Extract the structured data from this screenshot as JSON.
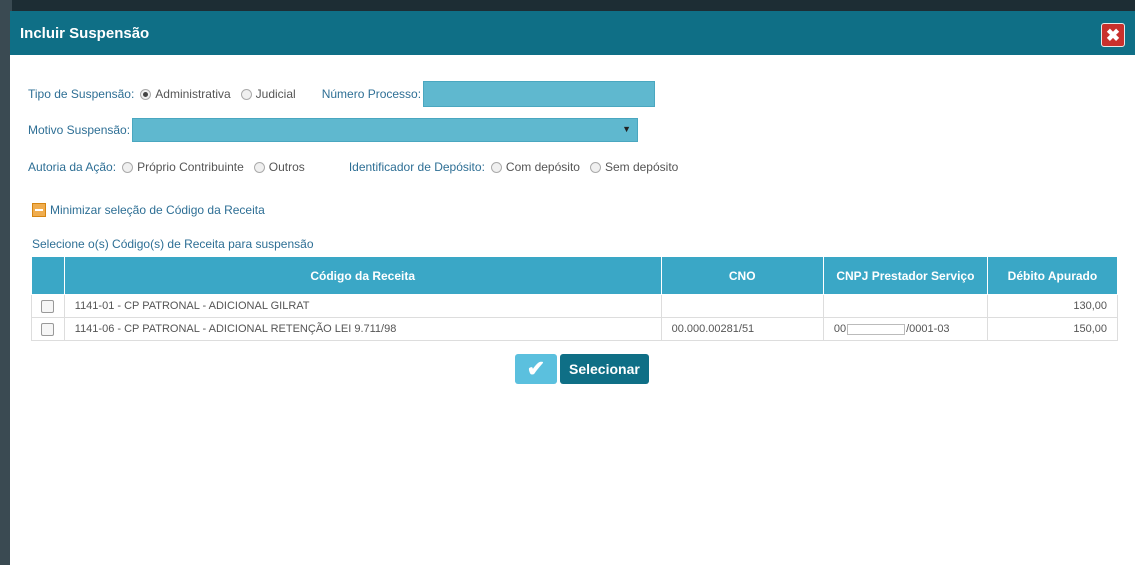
{
  "dialog": {
    "title": "Incluir Suspensão",
    "close_label": "✖"
  },
  "form": {
    "tipo_label": "Tipo de Suspensão:",
    "tipo_options": [
      "Administrativa",
      "Judicial"
    ],
    "tipo_selected": "Administrativa",
    "numero_processo_label": "Número Processo:",
    "numero_processo_value": "",
    "motivo_label": "Motivo Suspensão:",
    "motivo_value": "",
    "autoria_label": "Autoria da Ação:",
    "autoria_options": [
      "Próprio Contribuinte",
      "Outros"
    ],
    "identificador_label": "Identificador de Depósito:",
    "identificador_options": [
      "Com depósito",
      "Sem depósito"
    ],
    "minimizar_label": "Minimizar seleção de Código da Receita",
    "selecione_label": "Selecione o(s) Código(s) de Receita para suspensão"
  },
  "table": {
    "headers": [
      "Código da Receita",
      "CNO",
      "CNPJ Prestador Serviço",
      "Débito Apurado"
    ],
    "rows": [
      {
        "codigo": "1141-01 - CP PATRONAL - ADICIONAL GILRAT",
        "cno": "",
        "cnpj_prefix": "",
        "cnpj_suffix": "",
        "debito": "130,00"
      },
      {
        "codigo": "1141-06 - CP PATRONAL - ADICIONAL RETENÇÃO LEI 9.711/98",
        "cno": "00.000.00281/51",
        "cnpj_prefix": "00",
        "cnpj_suffix": "/0001-03",
        "debito": "150,00"
      }
    ]
  },
  "actions": {
    "check_icon": "✔",
    "selecionar_label": "Selecionar"
  },
  "colors": {
    "titlebar": "#0f6f86",
    "accent": "#3aa7c6",
    "input": "#5fb8cf",
    "close": "#c9302c"
  }
}
